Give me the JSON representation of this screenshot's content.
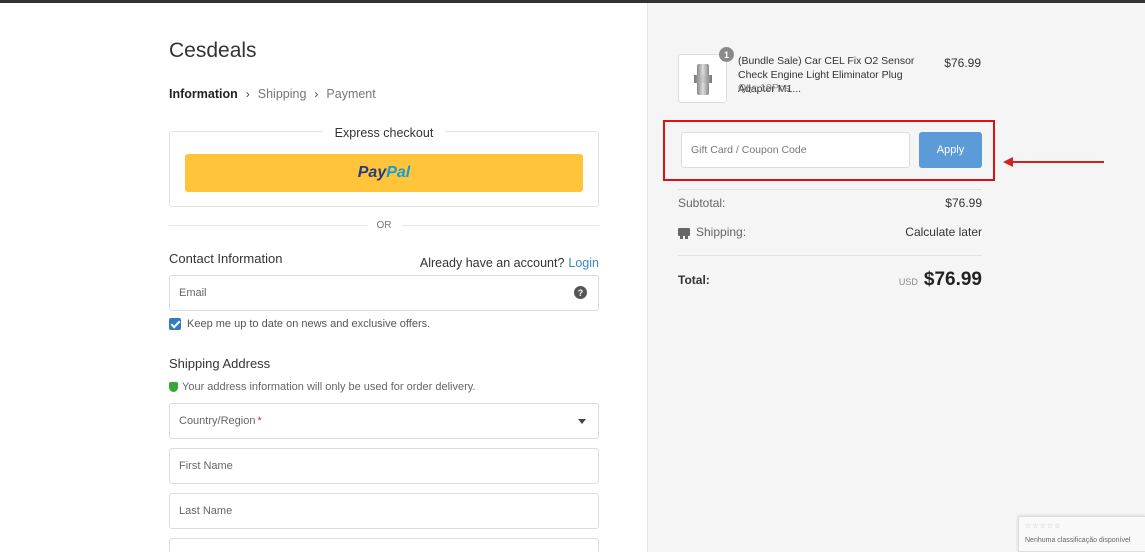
{
  "store": {
    "name": "Cesdeals"
  },
  "breadcrumb": {
    "step1": "Information",
    "step2": "Shipping",
    "step3": "Payment"
  },
  "express": {
    "label": "Express checkout",
    "paypal_part1": "Pay",
    "paypal_part2": "Pal",
    "or": "OR"
  },
  "contact": {
    "title": "Contact Information",
    "account_prompt": "Already have an account?",
    "login_label": "Login",
    "email_placeholder": "Email",
    "keep_updated": "Keep me up to date on news and exclusive offers."
  },
  "shipping": {
    "title": "Shipping Address",
    "note": "Your address information will only be used for order delivery.",
    "country_placeholder": "Country/Region",
    "required_mark": "*",
    "first_name_placeholder": "First Name",
    "last_name_placeholder": "Last Name"
  },
  "cart": {
    "item": {
      "quantity_badge": "1",
      "name": "(Bundle Sale) Car CEL Fix O2 Sensor Check Engine Light Eliminator Plug Adapter M1...",
      "qty": "Qty: 10Pcs",
      "price": "$76.99"
    },
    "coupon": {
      "placeholder": "Gift Card / Coupon Code",
      "apply_label": "Apply"
    },
    "subtotal": {
      "label": "Subtotal:",
      "value": "$76.99"
    },
    "shipping": {
      "label": "Shipping:",
      "value": "Calculate later"
    },
    "total": {
      "label": "Total:",
      "currency": "USD",
      "amount": "$76.99"
    }
  },
  "recaptcha": {
    "stars": "☆☆☆☆☆",
    "text": "Nenhuma classificação disponível"
  },
  "colors": {
    "accent": "#5b9bd8",
    "link": "#3a86c8",
    "paypal": "#ffc43a",
    "highlight": "#e01010",
    "checkbox": "#2f7dc0"
  },
  "icons": [
    "chevron-right-icon",
    "help-icon",
    "checkbox-icon",
    "shield-icon",
    "dropdown-arrow-icon",
    "truck-icon",
    "red-arrow-icon"
  ]
}
